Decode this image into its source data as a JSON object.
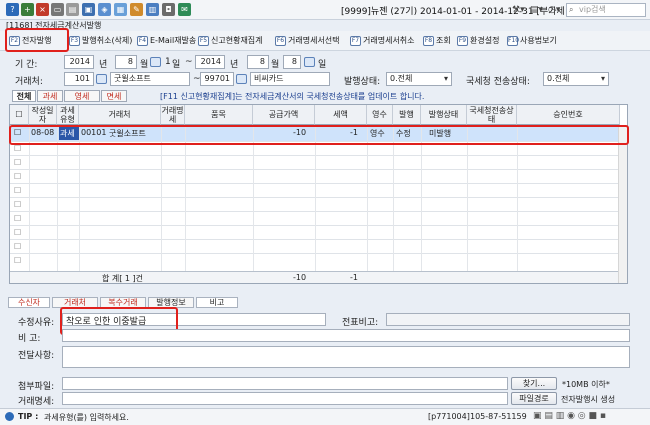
{
  "topbar": {
    "company": "[9999]뉴젠 (27기) 2014-01-01 - 2014-12-31 [부가세 2014] [원천 2014]",
    "search_placeholder": "vip검색"
  },
  "window_title": "[1168] 전자세금계산서발행",
  "toolbar": {
    "items": [
      {
        "key": "F2",
        "label": "전자발행"
      },
      {
        "key": "F3",
        "label": "발행취소(삭제)"
      },
      {
        "key": "F4",
        "label": "E-Mail재발송"
      },
      {
        "key": "F5",
        "label": "신고현황재집계"
      },
      {
        "key": "F6",
        "label": "거래명세서선택"
      },
      {
        "key": "F7",
        "label": "거래명세서취소"
      },
      {
        "key": "F8",
        "label": "조회"
      },
      {
        "key": "F9",
        "label": "환경설정"
      },
      {
        "key": "F10",
        "label": "사용법보기"
      }
    ]
  },
  "filter": {
    "period_label": "기    간:",
    "from_year": "2014",
    "year_unit": "년",
    "from_month": "8",
    "month_unit": "월",
    "from_day": "1",
    "day_unit": "일",
    "sep": "~",
    "to_year": "2014",
    "to_month": "8",
    "to_day": "8",
    "partner_label": "거래처:",
    "partner_from_code": "101",
    "partner_from_name": "굿윌소프트",
    "partner_to_code": "99701",
    "partner_to_name": "비씨카드",
    "issue_status_label": "발행상태:",
    "issue_status_value": "0.전체",
    "nts_status_label": "국세청 전송상태:",
    "nts_status_value": "0.전체"
  },
  "tabs": [
    "전체",
    "과세",
    "영세",
    "면세"
  ],
  "notice": "[F11 신고현황재집계]는 전자세금계산서의 국세청전송상태를 업데이트 합니다.",
  "grid": {
    "headers": [
      "작성일자",
      "과세유형",
      "거래처",
      "거래명세",
      "품목",
      "공급가액",
      "세액",
      "영수",
      "발행",
      "발행상태",
      "국세청전송상태",
      "승인번호"
    ],
    "row": {
      "date": "08-08",
      "type": "과세",
      "code": "00101",
      "name": "굿윌소프트",
      "supply": "-10",
      "tax": "-1",
      "receipt": "영수",
      "issue": "수정",
      "status": "미발행"
    },
    "total_label": "합   계[ 1 ]건",
    "total_supply": "-10",
    "total_tax": "-1"
  },
  "bottom_tabs": [
    "수신자",
    "거래처",
    "복수거래",
    "발행정보",
    "비고"
  ],
  "bottom": {
    "reason_label": "수정사유:",
    "reason_value": "착오로 인한 이중발급",
    "memo_label": "전표비고:",
    "note_label": "비    고:",
    "delivery_label": "전달사항:",
    "attach_label": "첨부파일:",
    "find_button": "찾기...",
    "attach_limit": "*10MB 이하*",
    "statement_label": "거래명세:",
    "path_button": "파일경로",
    "auto_note": "전자발행시 생성"
  },
  "status": {
    "tip_label": "TIP :",
    "tip_text": "과세유형(를) 입력하세요.",
    "user": "[p771004]",
    "code": "105-87-51159"
  },
  "colors": {
    "accent": "#2b57a8",
    "highlight": "#e0201c",
    "selected_row": "#cfe3fb"
  }
}
